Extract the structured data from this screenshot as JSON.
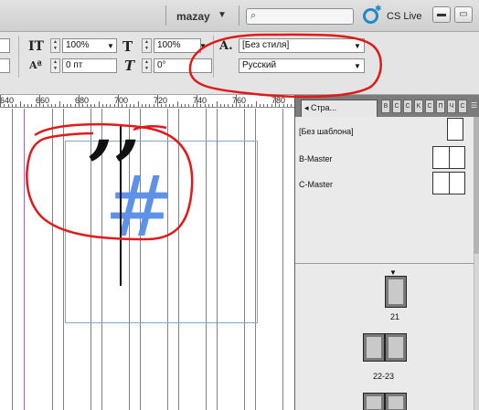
{
  "appbar": {
    "user_name": "mazay",
    "search_placeholder": "",
    "service_label": "CS Live"
  },
  "control_panel": {
    "row1": {
      "vertical_scale": "100%",
      "horizontal_scale": "100%",
      "paragraph_style": "[Без стиля]"
    },
    "row2": {
      "baseline_shift": "0 пт",
      "skew": "0°",
      "language": "Русский"
    }
  },
  "ruler": {
    "labels": [
      "640",
      "660",
      "680",
      "700",
      "720",
      "740",
      "760",
      "780"
    ]
  },
  "panel": {
    "tab_label": "Стра...",
    "masters": [
      {
        "label": "[Без шаблона]",
        "spread": "single"
      },
      {
        "label": "B-Master",
        "spread": "double"
      },
      {
        "label": "C-Master",
        "spread": "double"
      }
    ],
    "pages": [
      {
        "number": "21"
      },
      {
        "number": "22-23"
      }
    ]
  },
  "document": {
    "glyphs": {
      "quote": "’’",
      "hash": "#"
    }
  },
  "colors": {
    "annotation": "#e01a1a",
    "column_guide": "#9b6bc0",
    "hash_glyph": "#5d92e8",
    "cs_live": "#1d89c9"
  }
}
